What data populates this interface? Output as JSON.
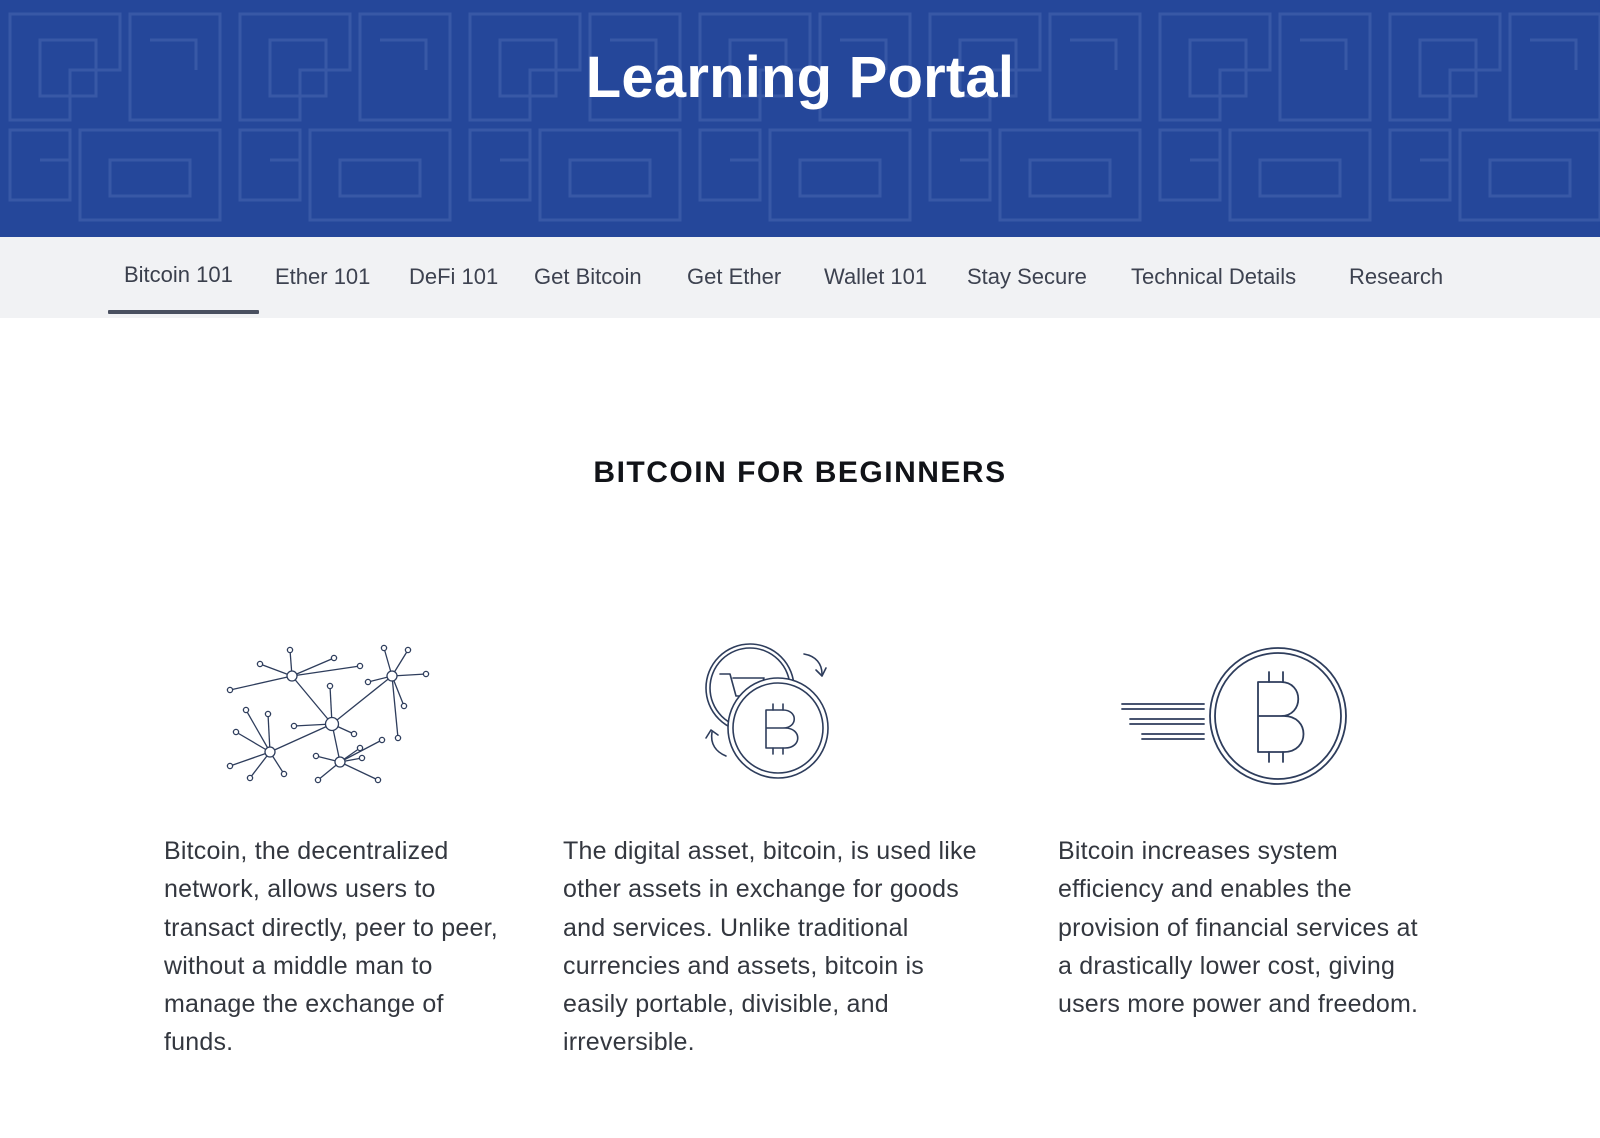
{
  "header": {
    "title": "Learning Portal"
  },
  "nav": {
    "tabs": [
      {
        "label": "Bitcoin 101",
        "active": true
      },
      {
        "label": "Ether 101"
      },
      {
        "label": "DeFi 101"
      },
      {
        "label": "Get Bitcoin"
      },
      {
        "label": "Get Ether"
      },
      {
        "label": "Wallet 101"
      },
      {
        "label": "Stay Secure"
      },
      {
        "label": "Technical Details"
      },
      {
        "label": "Research"
      }
    ]
  },
  "section": {
    "title": "BITCOIN FOR BEGINNERS"
  },
  "features": [
    {
      "icon": "network-icon",
      "text": "Bitcoin, the decentralized network, allows users to transact directly, peer to peer, without a middle man to manage the exchange of funds."
    },
    {
      "icon": "bitcoin-exchange-icon",
      "text": "The digital asset, bitcoin, is used like other assets in exchange for goods and services. Unlike traditional currencies and assets, bitcoin is easily portable, divisible, and irreversible."
    },
    {
      "icon": "fast-bitcoin-icon",
      "text": "Bitcoin increases system efficiency and enables the provision of financial services at a drastically lower cost, giving users more power and freedom."
    }
  ],
  "colors": {
    "header_bg": "#25479a",
    "nav_bg": "#f1f2f4",
    "icon_stroke": "#2e3d5c"
  }
}
